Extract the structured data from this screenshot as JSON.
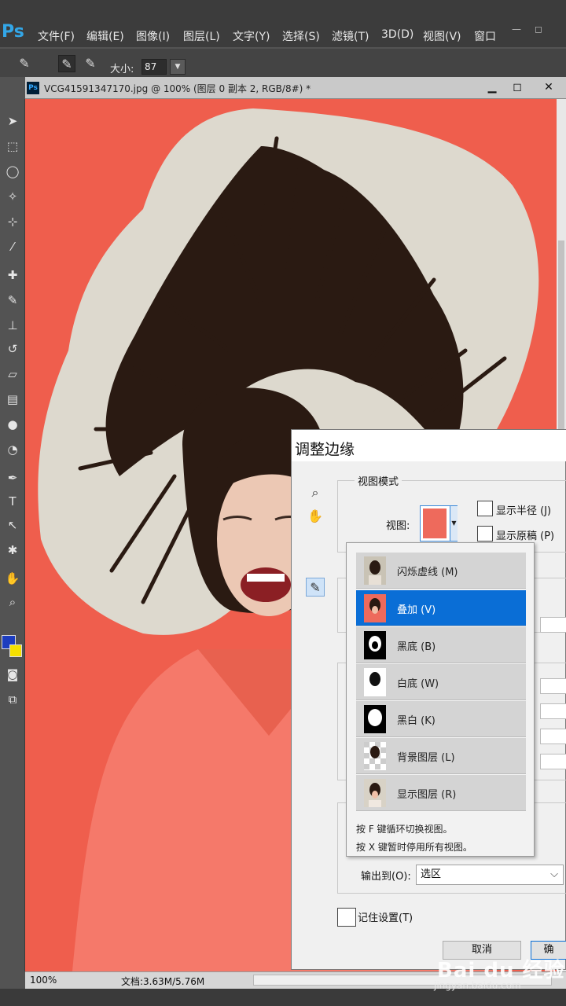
{
  "app": {
    "logo": "Ps"
  },
  "menu": [
    "文件(F)",
    "编辑(E)",
    "图像(I)",
    "图层(L)",
    "文字(Y)",
    "选择(S)",
    "滤镜(T)",
    "3D(D)",
    "视图(V)",
    "窗口"
  ],
  "window_controls": [
    "—",
    "◻"
  ],
  "options_bar": {
    "size_label": "大小:",
    "size_value": "87"
  },
  "document": {
    "title": "VCG41591347170.jpg @ 100% (图层 0 副本 2, RGB/8#) *",
    "zoom": "100%",
    "doc_size": "文档:3.63M/5.76M"
  },
  "colors": {
    "canvas_bg": "#ef5e4d",
    "accent": "#0a6ed6",
    "foreground": "#1d3dbf",
    "background": "#f5e000"
  },
  "dialog": {
    "title": "调整边缘",
    "view_mode_group": "视图模式",
    "view_label": "视图:",
    "show_radius": "显示半径 (J)",
    "show_original": "显示原稿 (P)",
    "view_options": [
      {
        "label": "闪烁虚线 (M)",
        "selected": false
      },
      {
        "label": "叠加 (V)",
        "selected": true
      },
      {
        "label": "黑底 (B)",
        "selected": false
      },
      {
        "label": "白底 (W)",
        "selected": false
      },
      {
        "label": "黑白 (K)",
        "selected": false
      },
      {
        "label": "背景图层 (L)",
        "selected": false
      },
      {
        "label": "显示图层 (R)",
        "selected": false
      }
    ],
    "hint_1": "按 F 键循环切换视图。",
    "hint_2": "按 X 键暂时停用所有视图。",
    "output_label": "输出到(O):",
    "output_value": "选区",
    "remember_label": "记住设置(T)",
    "cancel_button": "取消",
    "ok_button": "确"
  },
  "watermark": {
    "logo": "Bai du 经验",
    "url": "jingyan.baidu.com"
  }
}
